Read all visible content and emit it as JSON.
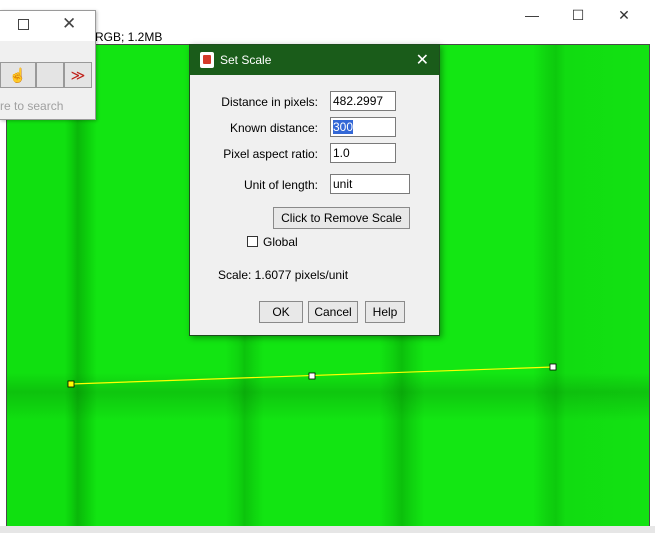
{
  "image_window": {
    "info": "RGB; 1.2MB",
    "controls": [
      "—",
      "☐",
      "✕"
    ],
    "line_selection": {
      "color": "#ffff00",
      "handle_color": "#ffff00"
    }
  },
  "toolbar_window": {
    "close_glyph": "✕",
    "tools": [
      "☝",
      "",
      "≫"
    ],
    "search_placeholder": "re to search"
  },
  "dialog": {
    "title": "Set Scale",
    "close_glyph": "✕",
    "fields": [
      {
        "label": "Distance in pixels:",
        "value": "482.2997"
      },
      {
        "label": "Known distance:",
        "value": "300"
      },
      {
        "label": "Pixel aspect ratio:",
        "value": "1.0"
      },
      {
        "label": "Unit of length:",
        "value": "unit"
      }
    ],
    "remove_scale_label": "Click to Remove Scale",
    "global_label": "Global",
    "scale_text": "Scale: 1.6077 pixels/unit",
    "buttons": {
      "ok": "OK",
      "cancel": "Cancel",
      "help": "Help"
    }
  },
  "colors": {
    "dialog_title_bg": "#1a5c1a",
    "canvas_green": "#12e512"
  }
}
